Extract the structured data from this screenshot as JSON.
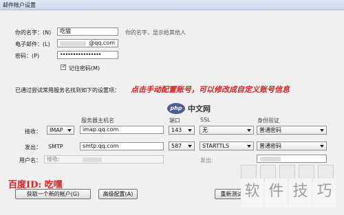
{
  "window": {
    "title": "邮件帐户设置"
  },
  "identity": {
    "name_label": "你的名字：(N)",
    "name_value": "吃猫",
    "name_hint": "你的名字，显示给其他人",
    "email_label": "电子邮件：(L)",
    "email_value": "@qq.com",
    "password_label": "密码：(P)",
    "password_value": "••••••••••••••••",
    "remember_label": "记住密码(M)",
    "remember_checked": true
  },
  "found_text": "已通过尝试常用服务名找到如下的设置项：",
  "annotation": "点击手动配置账号，可以修改成自定义账号信息",
  "columns": {
    "hostname": "服务器主机名",
    "port": "端口",
    "ssl": "SSL",
    "auth": "身份验证"
  },
  "incoming": {
    "label": "接收：",
    "protocol": "IMAP",
    "host": "imap.qq.com",
    "port": "143",
    "ssl": "无",
    "auth": "普通密码"
  },
  "outgoing": {
    "label": "发出：",
    "protocol": "SMTP",
    "host": "smtp.qq.com",
    "port": "587",
    "ssl": "STARTTLS",
    "auth": "普通密码"
  },
  "username": {
    "label": "用户名：",
    "incoming_hint": "接收:",
    "outgoing_hint": "发出:"
  },
  "watermark": {
    "php_logo": "php",
    "php_text": "中文网",
    "author": "百度ID: 吃嘿",
    "brand_chars": [
      "软",
      "件",
      "技",
      "巧"
    ]
  },
  "buttons": {
    "get_new_account": "获取一个新的帐户(G)",
    "advanced_config": "高级配置(A)",
    "retest": "重新测试(T)"
  }
}
